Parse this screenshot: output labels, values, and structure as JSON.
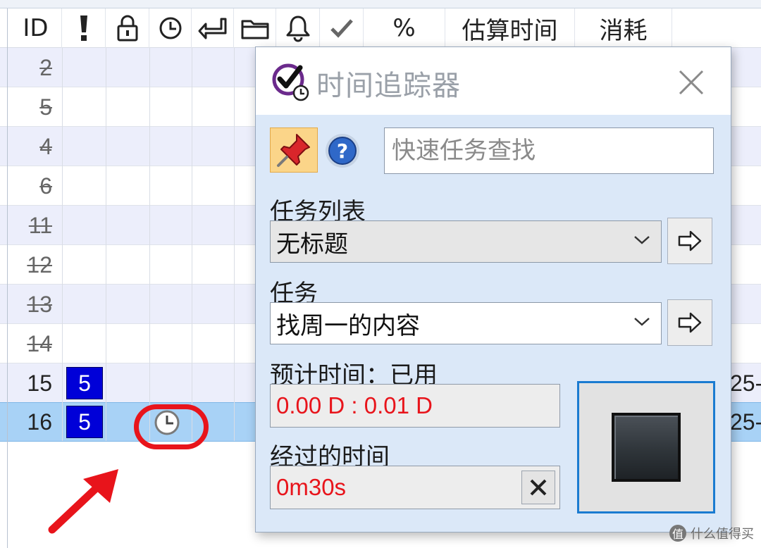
{
  "grid": {
    "header": {
      "id": "ID",
      "percent": "%",
      "estimate": "估算时间",
      "consumed": "消耗"
    },
    "rows": [
      {
        "id": "2",
        "done": true,
        "priority": ""
      },
      {
        "id": "5",
        "done": true,
        "priority": ""
      },
      {
        "id": "4",
        "done": true,
        "priority": ""
      },
      {
        "id": "6",
        "done": true,
        "priority": ""
      },
      {
        "id": "11",
        "done": true,
        "priority": ""
      },
      {
        "id": "12",
        "done": true,
        "priority": ""
      },
      {
        "id": "13",
        "done": true,
        "priority": ""
      },
      {
        "id": "14",
        "done": true,
        "priority": ""
      },
      {
        "id": "15",
        "done": false,
        "priority": "5",
        "edge_text": "25-"
      },
      {
        "id": "16",
        "done": false,
        "priority": "5",
        "edge_text": "25-",
        "selected": true,
        "tracking": true
      }
    ],
    "icons": [
      "priority-exclamation-icon",
      "lock-icon",
      "clock-icon",
      "return-arrow-icon",
      "folder-icon",
      "bell-icon",
      "checkmark-icon"
    ]
  },
  "dialog": {
    "title": "时间追踪器",
    "search_placeholder": "快速任务查找",
    "tasklist_label": "任务列表",
    "tasklist_value": "无标题",
    "task_label": "任务",
    "task_value": "找周一的内容",
    "estimate_label": "预计时间：已用",
    "estimate_value": "0.00 D : 0.01 D",
    "elapsed_label": "经过的时间",
    "elapsed_value": "0m30s"
  },
  "watermark": {
    "badge": "值",
    "text": "什么值得买"
  },
  "colors": {
    "priority_fill": "#0000d8",
    "selected_row": "#a8d2f6",
    "alt_row": "#eceefb",
    "dialog_bg": "#dbe8f8",
    "value_red": "#e8141b",
    "stop_border": "#1a7bd1"
  }
}
